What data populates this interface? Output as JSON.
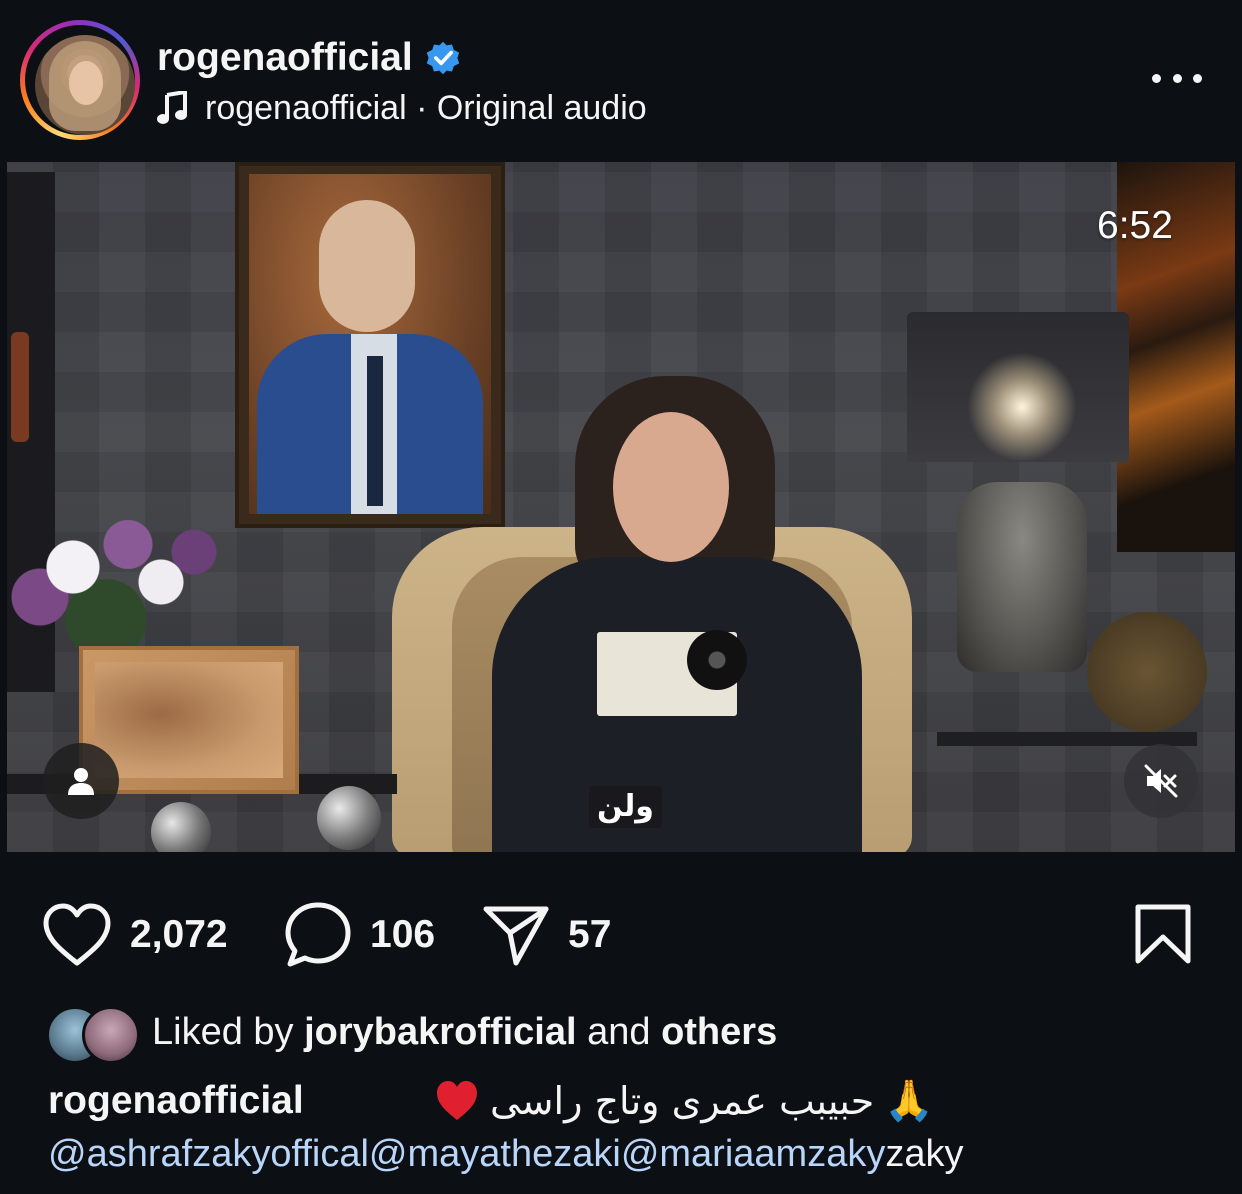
{
  "header": {
    "username": "rogenaofficial",
    "audio_owner": "rogenaofficial",
    "audio_separator": " · ",
    "audio_label": "Original audio",
    "verified_color": "#3897f0"
  },
  "video": {
    "duration": "6:52",
    "caption_overlay": "ولن"
  },
  "actions": {
    "likes": "2,072",
    "comments": "106",
    "shares": "57"
  },
  "liked_by": {
    "prefix": "Liked by",
    "user": "jorybakrofficial",
    "middle": "and",
    "suffix": "others"
  },
  "caption": {
    "username": "rogenaofficial",
    "text": "حبيبب عمرى وتاج راسى",
    "emoji_heart": "❤️",
    "emoji_pray": "🙏",
    "mentions": [
      "@ashrafzakyoffical",
      "@mayathezaki",
      "@mariaamzaky"
    ],
    "trailing": "zaky"
  },
  "colors": {
    "background": "#0c1014",
    "text": "#f5f5f5",
    "mention": "#b9d5f9"
  }
}
